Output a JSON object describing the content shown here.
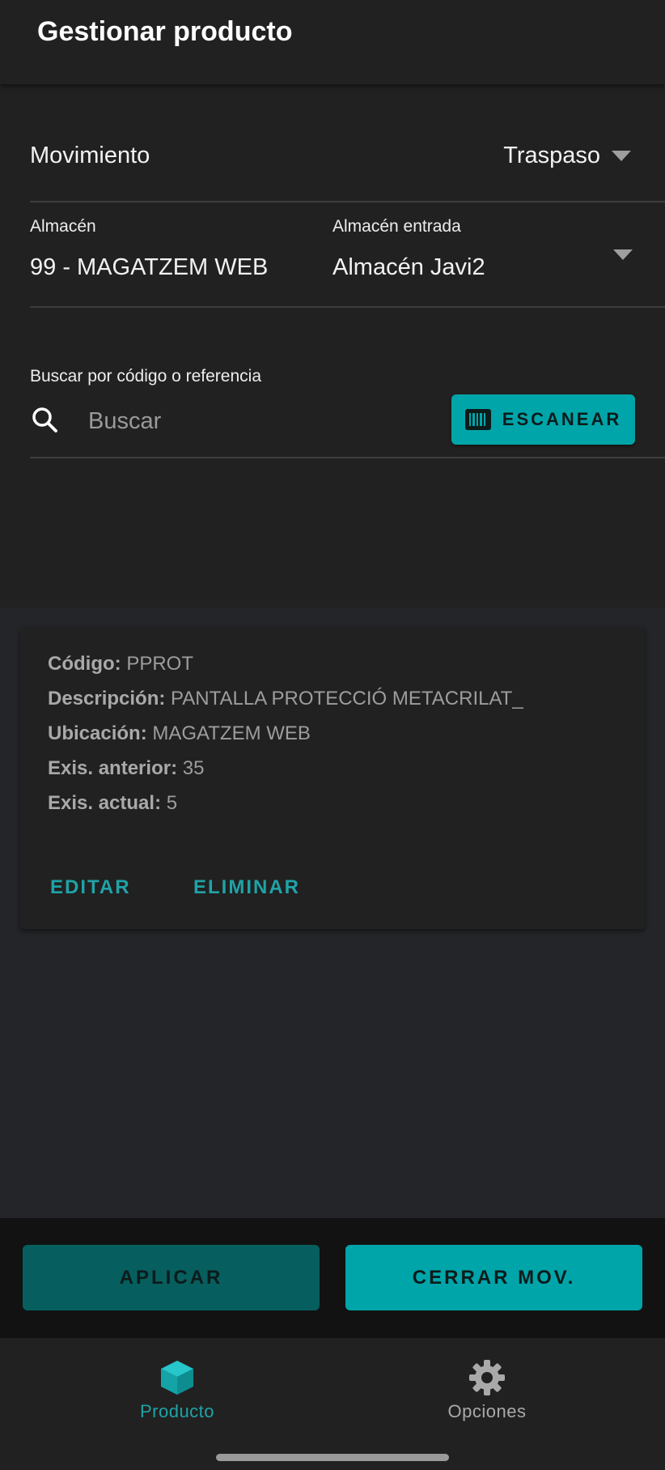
{
  "appbar": {
    "title": "Gestionar producto"
  },
  "movimiento": {
    "label": "Movimiento",
    "value": "Traspaso"
  },
  "almacen": {
    "origen_label": "Almacén",
    "origen_value": "99 - MAGATZEM WEB",
    "entrada_label": "Almacén entrada",
    "entrada_value": "Almacén Javi2"
  },
  "search": {
    "label": "Buscar por código o referencia",
    "placeholder": "Buscar",
    "value": "",
    "scan_label": "ESCANEAR"
  },
  "product_card": {
    "codigo_label": "Código:",
    "codigo_value": "PPROT",
    "descripcion_label": "Descripción:",
    "descripcion_value": "PANTALLA PROTECCIÓ METACRILAT_",
    "ubicacion_label": "Ubicación:",
    "ubicacion_value": "MAGATZEM WEB",
    "exis_anterior_label": "Exis. anterior:",
    "exis_anterior_value": "35",
    "exis_actual_label": "Exis. actual:",
    "exis_actual_value": "5",
    "edit_label": "EDITAR",
    "delete_label": "ELIMINAR"
  },
  "actions": {
    "aplicar_label": "APLICAR",
    "cerrar_label": "CERRAR MOV."
  },
  "bottom_nav": {
    "items": [
      {
        "label": "Producto",
        "icon": "cube-icon",
        "active": true
      },
      {
        "label": "Opciones",
        "icon": "gear-icon",
        "active": false
      }
    ]
  },
  "colors": {
    "accent": "#00a5a9",
    "accent_dark": "#075e5f",
    "surface": "#212121",
    "background": "#242529"
  }
}
